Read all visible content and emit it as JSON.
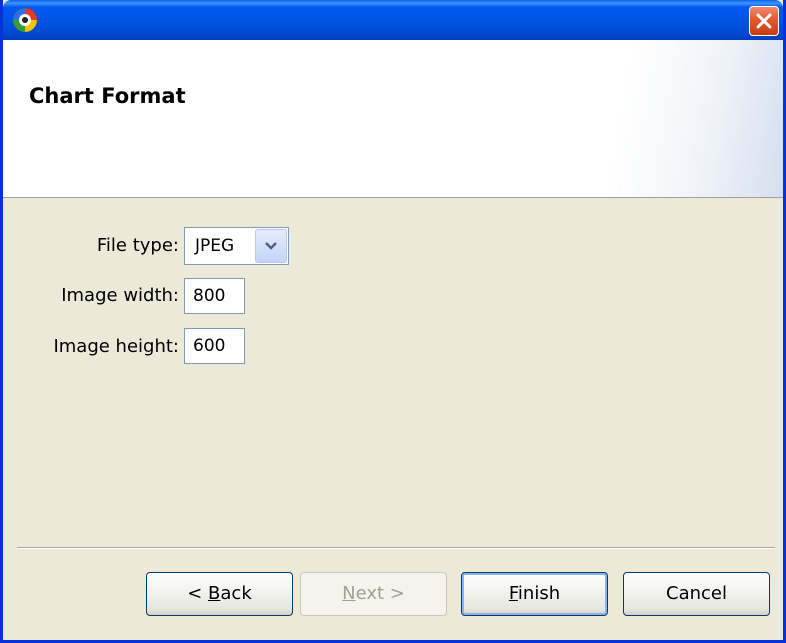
{
  "window": {
    "close_label": ""
  },
  "header": {
    "title": "Chart Format"
  },
  "form": {
    "file_type": {
      "label": "File type:",
      "value": "JPEG"
    },
    "image_width": {
      "label": "Image width:",
      "value": "800"
    },
    "image_height": {
      "label": "Image height:",
      "value": "600"
    }
  },
  "buttons": {
    "back": {
      "mnemonic": "B",
      "pre": "< ",
      "rest": "ack"
    },
    "next": {
      "mnemonic": "N",
      "pre": "",
      "rest": "ext >"
    },
    "finish": {
      "mnemonic": "F",
      "pre": "",
      "rest": "inish"
    },
    "cancel": {
      "label": "Cancel"
    }
  },
  "colors": {
    "titlebar": "#0055e6",
    "body": "#ece9d8",
    "close": "#e25a2e"
  },
  "icons": {
    "app": "eclipse-birt-icon",
    "close": "close-icon",
    "dropdown": "chevron-down-icon"
  }
}
